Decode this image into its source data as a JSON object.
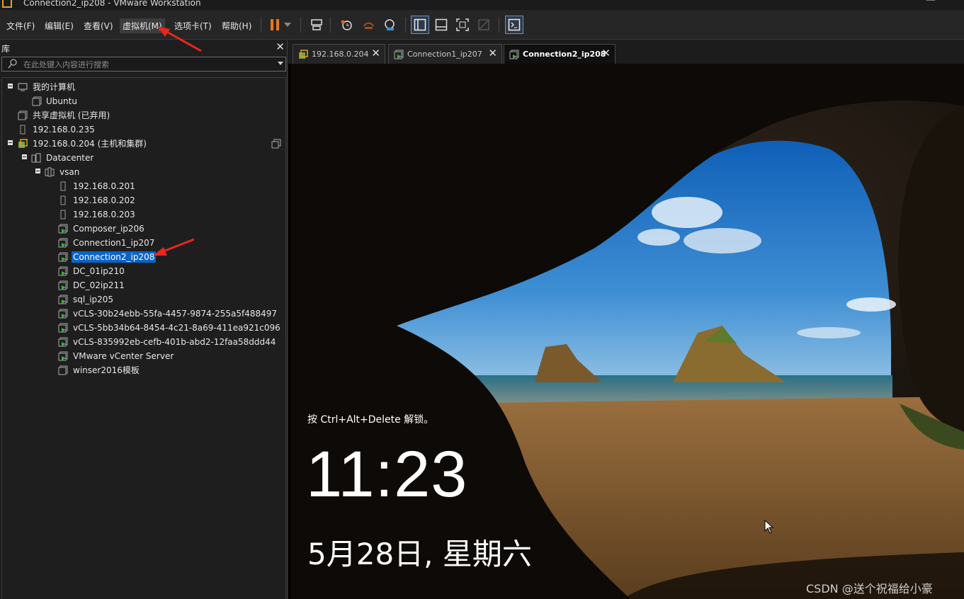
{
  "window": {
    "title": "Connection2_ip208 - VMware Workstation",
    "min_glyph": "—"
  },
  "menubar": {
    "items": [
      "文件(F)",
      "编辑(E)",
      "查看(V)",
      "虚拟机(M)",
      "选项卡(T)",
      "帮助(H)"
    ],
    "toolbar_icons": [
      "pause-icon",
      "dropdown-icon",
      "send-ctrl-alt-del-icon",
      "snapshot-icon",
      "revert-snapshot-icon",
      "snapshot-manager-icon",
      "library-view-icon",
      "thumbnail-bar-icon",
      "fullscreen-icon",
      "unity-icon",
      "console-view-icon"
    ],
    "accent": "#e8761e"
  },
  "sidebar": {
    "title": "库",
    "close_glyph": "✕",
    "search_placeholder": "在此处键入内容进行搜索",
    "tree": [
      {
        "label": "我的计算机"
      },
      {
        "label": "Ubuntu"
      },
      {
        "label": "共享虚拟机 (已弃用)"
      },
      {
        "label": "192.168.0.235"
      },
      {
        "label": "192.168.0.204 (主机和集群)"
      },
      {
        "label": "Datacenter"
      },
      {
        "label": "vsan"
      },
      {
        "label": "192.168.0.201"
      },
      {
        "label": "192.168.0.202"
      },
      {
        "label": "192.168.0.203"
      },
      {
        "label": "Composer_ip206"
      },
      {
        "label": "Connection1_ip207"
      },
      {
        "label": "Connection2_ip208",
        "selected": true
      },
      {
        "label": "DC_01ip210"
      },
      {
        "label": "DC_02ip211"
      },
      {
        "label": "sql_ip205"
      },
      {
        "label": "vCLS-30b24ebb-55fa-4457-9874-255a5f488497"
      },
      {
        "label": "vCLS-5bb34b64-8454-4c21-8a69-411ea921c096"
      },
      {
        "label": "vCLS-835992eb-cefb-401b-abd2-12faa58ddd44"
      },
      {
        "label": "VMware vCenter Server"
      },
      {
        "label": "winser2016模板"
      }
    ]
  },
  "tabs": [
    {
      "label": "192.168.0.204",
      "active": false
    },
    {
      "label": "Connection1_ip207",
      "active": false
    },
    {
      "label": "Connection2_ip208",
      "active": true
    }
  ],
  "tab_close_glyph": "✕",
  "lockscreen": {
    "hint": "按 Ctrl+Alt+Delete 解锁。",
    "time": "11:23",
    "date": "5月28日, 星期六"
  },
  "watermark": "CSDN @送个祝福给小豪",
  "selection_color": "#0a64c8"
}
